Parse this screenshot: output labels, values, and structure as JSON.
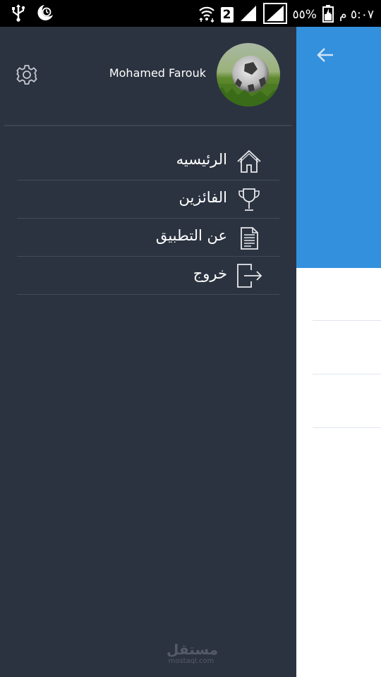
{
  "status_bar": {
    "battery_percent": "٥٥%",
    "time": "٥:٠٧ م",
    "sim_slot": "2",
    "icons": [
      "usb-icon",
      "alarm-icon",
      "wifi-icon",
      "signal-icon",
      "signal-icon",
      "battery-charging-icon"
    ]
  },
  "drawer": {
    "user_name": "Mohamed Farouk",
    "menu": [
      {
        "label": "الرئيسيه",
        "icon": "home-icon"
      },
      {
        "label": "الفائزين",
        "icon": "trophy-icon"
      },
      {
        "label": "عن التطبيق",
        "icon": "document-icon"
      },
      {
        "label": "خروج",
        "icon": "logout-icon"
      }
    ],
    "watermark": {
      "main": "مستقل",
      "sub": "mostaql.com"
    }
  },
  "background_app": {
    "header_color": "#3390dd"
  },
  "colors": {
    "drawer_bg": "#2c3340",
    "accent": "#3390dd",
    "divider": "#434b59"
  }
}
